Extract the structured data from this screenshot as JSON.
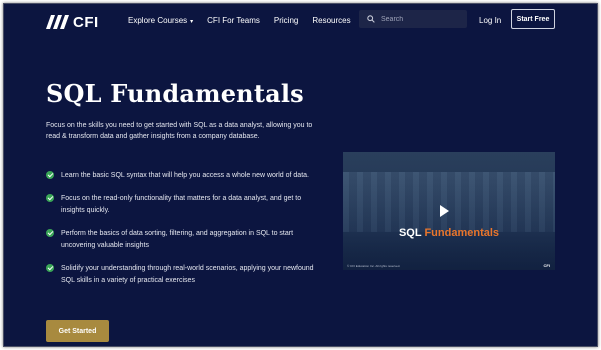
{
  "header": {
    "logo_text": "CFI",
    "nav": [
      {
        "label": "Explore Courses",
        "has_dropdown": true
      },
      {
        "label": "CFI For Teams"
      },
      {
        "label": "Pricing"
      },
      {
        "label": "Resources"
      }
    ],
    "search_placeholder": "Search",
    "login_label": "Log In",
    "start_free_label": "Start Free"
  },
  "hero": {
    "title": "SQL Fundamentals",
    "intro": "Focus on the skills you need to get started with SQL as a data analyst, allowing you to read & transform data and gather insights from a company database.",
    "bullets": [
      "Learn the basic SQL syntax that will help you access a whole new world of data.",
      "Focus on the read-only functionality that matters for a data analyst, and get to insights quickly.",
      "Perform the basics of data sorting, filtering, and aggregation in SQL to start uncovering valuable insights",
      "Solidify your understanding through real-world scenarios, applying your newfound SQL skills in a variety of practical exercises"
    ],
    "cta_label": "Get Started"
  },
  "video": {
    "title_part1": "SQL ",
    "title_part2": "Fundamentals",
    "footer_text": "© CFI Education Inc. All rights reserved.",
    "logo_text": "CFI"
  },
  "colors": {
    "background": "#0c1540",
    "accent_gold": "#a88a3f",
    "check_green": "#3aa657",
    "video_accent": "#e9752c"
  }
}
